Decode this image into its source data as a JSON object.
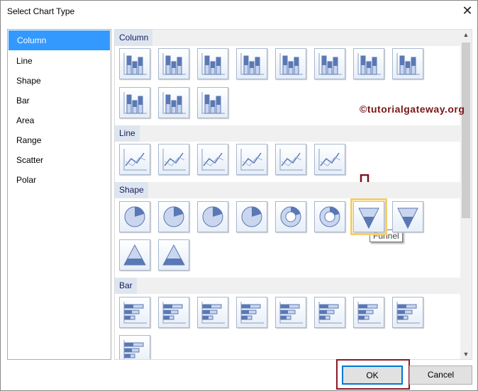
{
  "dialog": {
    "title": "Select Chart Type",
    "close_label": "✕"
  },
  "categories": [
    "Column",
    "Line",
    "Shape",
    "Bar",
    "Area",
    "Range",
    "Scatter",
    "Polar"
  ],
  "selected_category": "Column",
  "sections": [
    {
      "label": "Column",
      "icons": [
        "column",
        "stacked-column",
        "100-stacked-column",
        "3d-column",
        "3d-stacked-column",
        "3d-100-stacked-column",
        "3d-clustered-column",
        "cylinder",
        "stacked-cylinder",
        "100-stacked-cylinder",
        "3d-cylinder"
      ]
    },
    {
      "label": "Line",
      "icons": [
        "line",
        "smooth-line",
        "stepped-line",
        "3d-line",
        "line-markers",
        "smooth-line-markers"
      ]
    },
    {
      "label": "Shape",
      "icons": [
        "pie",
        "exploded-pie",
        "3d-pie",
        "3d-exploded-pie",
        "doughnut",
        "exploded-doughnut",
        "funnel",
        "3d-funnel",
        "pyramid",
        "3d-pyramid"
      ]
    },
    {
      "label": "Bar",
      "icons": [
        "bar",
        "stacked-bar",
        "100-stacked-bar",
        "3d-bar",
        "3d-stacked-bar",
        "3d-100-stacked-bar",
        "cylinder-bar",
        "stacked-cylinder-bar",
        "100-stacked-cylinder-bar"
      ]
    }
  ],
  "selected_icon": "funnel",
  "tooltip": "Funnel",
  "watermark": "©tutorialgateway.org",
  "buttons": {
    "ok": "OK",
    "cancel": "Cancel"
  },
  "colors": {
    "selection": "#3399ff",
    "highlight_box": "#8b1a2a",
    "icon_blue": "#5a78b4"
  }
}
